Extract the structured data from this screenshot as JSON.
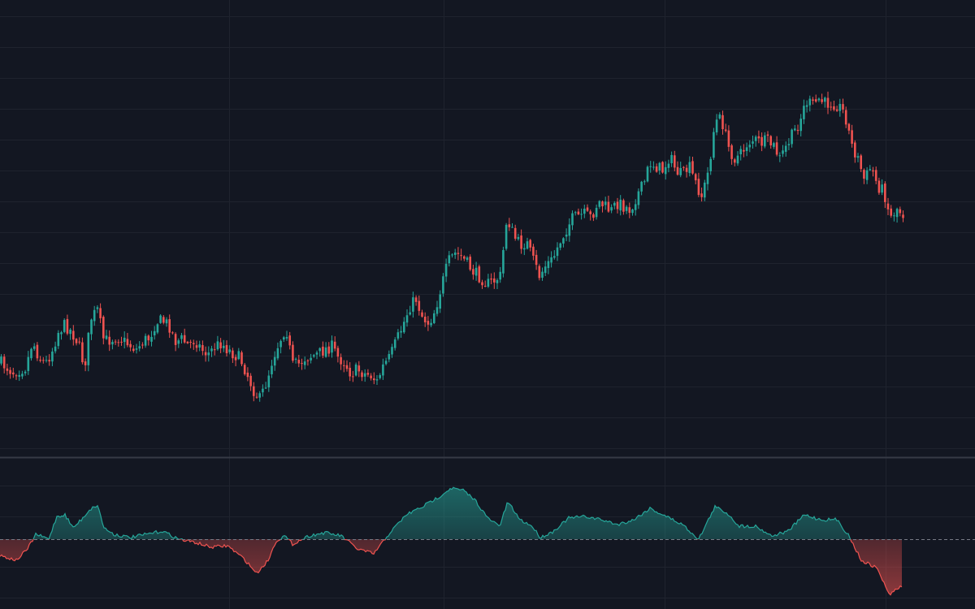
{
  "chart_data": [
    {
      "type": "candlestick",
      "title": "",
      "xlabel": "",
      "ylabel": "",
      "grid": true,
      "legend": "none",
      "colors": {
        "up": "#26a69a",
        "down": "#ef5350",
        "background": "#131722",
        "grid": "#1f232e"
      },
      "price_path": [
        [
          0,
          446
        ],
        [
          8,
          452
        ],
        [
          16,
          458
        ],
        [
          24,
          455
        ],
        [
          32,
          452
        ],
        [
          40,
          420
        ],
        [
          48,
          440
        ],
        [
          56,
          448
        ],
        [
          64,
          432
        ],
        [
          72,
          408
        ],
        [
          80,
          400
        ],
        [
          88,
          408
        ],
        [
          96,
          422
        ],
        [
          104,
          452
        ],
        [
          112,
          392
        ],
        [
          120,
          382
        ],
        [
          128,
          420
        ],
        [
          136,
          418
        ],
        [
          144,
          414
        ],
        [
          152,
          420
        ],
        [
          160,
          425
        ],
        [
          168,
          430
        ],
        [
          176,
          420
        ],
        [
          184,
          416
        ],
        [
          192,
          396
        ],
        [
          200,
          395
        ],
        [
          208,
          400
        ],
        [
          216,
          420
        ],
        [
          224,
          418
        ],
        [
          232,
          425
        ],
        [
          240,
          418
        ],
        [
          248,
          430
        ],
        [
          256,
          436
        ],
        [
          264,
          428
        ],
        [
          272,
          422
        ],
        [
          280,
          430
        ],
        [
          288,
          436
        ],
        [
          296,
          442
        ],
        [
          304,
          460
        ],
        [
          312,
          480
        ],
        [
          320,
          492
        ],
        [
          328,
          470
        ],
        [
          336,
          440
        ],
        [
          344,
          420
        ],
        [
          352,
          402
        ],
        [
          360,
          450
        ],
        [
          368,
          448
        ],
        [
          376,
          440
        ],
        [
          384,
          438
        ],
        [
          392,
          436
        ],
        [
          400,
          430
        ],
        [
          408,
          426
        ],
        [
          416,
          440
        ],
        [
          424,
          446
        ],
        [
          432,
          460
        ],
        [
          440,
          455
        ],
        [
          448,
          460
        ],
        [
          456,
          462
        ],
        [
          464,
          470
        ],
        [
          472,
          450
        ],
        [
          480,
          440
        ],
        [
          488,
          420
        ],
        [
          496,
          400
        ],
        [
          504,
          378
        ],
        [
          512,
          368
        ],
        [
          520,
          390
        ],
        [
          528,
          398
        ],
        [
          536,
          380
        ],
        [
          544,
          350
        ],
        [
          552,
          322
        ],
        [
          560,
          312
        ],
        [
          568,
          316
        ],
        [
          576,
          326
        ],
        [
          584,
          336
        ],
        [
          592,
          342
        ],
        [
          600,
          350
        ],
        [
          608,
          346
        ],
        [
          616,
          340
        ],
        [
          624,
          266
        ],
        [
          632,
          290
        ],
        [
          640,
          302
        ],
        [
          648,
          298
        ],
        [
          656,
          320
        ],
        [
          664,
          340
        ],
        [
          672,
          326
        ],
        [
          680,
          320
        ],
        [
          688,
          300
        ],
        [
          696,
          284
        ],
        [
          704,
          270
        ],
        [
          712,
          266
        ],
        [
          720,
          264
        ],
        [
          728,
          268
        ],
        [
          736,
          248
        ],
        [
          744,
          254
        ],
        [
          752,
          260
        ],
        [
          760,
          250
        ],
        [
          768,
          254
        ],
        [
          776,
          258
        ],
        [
          784,
          240
        ],
        [
          792,
          228
        ],
        [
          800,
          200
        ],
        [
          808,
          205
        ],
        [
          816,
          210
        ],
        [
          824,
          192
        ],
        [
          832,
          210
        ],
        [
          840,
          216
        ],
        [
          848,
          205
        ],
        [
          856,
          225
        ],
        [
          864,
          242
        ],
        [
          872,
          210
        ],
        [
          880,
          150
        ],
        [
          888,
          146
        ],
        [
          896,
          180
        ],
        [
          904,
          195
        ],
        [
          912,
          190
        ],
        [
          920,
          176
        ],
        [
          928,
          172
        ],
        [
          936,
          176
        ],
        [
          944,
          174
        ],
        [
          952,
          180
        ],
        [
          960,
          196
        ],
        [
          968,
          180
        ],
        [
          976,
          165
        ],
        [
          984,
          150
        ],
        [
          992,
          125
        ],
        [
          1000,
          130
        ],
        [
          1008,
          122
        ],
        [
          1016,
          128
        ],
        [
          1024,
          126
        ],
        [
          1032,
          130
        ],
        [
          1040,
          140
        ],
        [
          1048,
          178
        ],
        [
          1056,
          196
        ],
        [
          1064,
          222
        ],
        [
          1072,
          205
        ],
        [
          1080,
          228
        ],
        [
          1088,
          236
        ],
        [
          1096,
          268
        ],
        [
          1104,
          256
        ],
        [
          1112,
          264
        ]
      ],
      "histogram_path": [
        [
          0,
          684
        ],
        [
          20,
          690
        ],
        [
          34,
          676
        ],
        [
          44,
          658
        ],
        [
          60,
          664
        ],
        [
          70,
          636
        ],
        [
          80,
          634
        ],
        [
          90,
          650
        ],
        [
          100,
          640
        ],
        [
          110,
          628
        ],
        [
          120,
          622
        ],
        [
          128,
          650
        ],
        [
          140,
          658
        ],
        [
          160,
          662
        ],
        [
          180,
          658
        ],
        [
          200,
          654
        ],
        [
          220,
          664
        ],
        [
          240,
          668
        ],
        [
          260,
          674
        ],
        [
          280,
          672
        ],
        [
          300,
          688
        ],
        [
          316,
          706
        ],
        [
          330,
          690
        ],
        [
          340,
          666
        ],
        [
          350,
          660
        ],
        [
          360,
          670
        ],
        [
          380,
          660
        ],
        [
          400,
          656
        ],
        [
          420,
          660
        ],
        [
          440,
          676
        ],
        [
          460,
          682
        ],
        [
          480,
          656
        ],
        [
          500,
          634
        ],
        [
          520,
          624
        ],
        [
          540,
          612
        ],
        [
          555,
          601
        ],
        [
          570,
          604
        ],
        [
          585,
          616
        ],
        [
          600,
          638
        ],
        [
          615,
          648
        ],
        [
          625,
          618
        ],
        [
          640,
          640
        ],
        [
          655,
          648
        ],
        [
          665,
          662
        ],
        [
          680,
          655
        ],
        [
          700,
          638
        ],
        [
          720,
          636
        ],
        [
          740,
          640
        ],
        [
          760,
          646
        ],
        [
          780,
          640
        ],
        [
          800,
          626
        ],
        [
          820,
          636
        ],
        [
          840,
          646
        ],
        [
          860,
          664
        ],
        [
          880,
          624
        ],
        [
          895,
          632
        ],
        [
          910,
          648
        ],
        [
          930,
          648
        ],
        [
          950,
          660
        ],
        [
          970,
          654
        ],
        [
          990,
          634
        ],
        [
          1010,
          640
        ],
        [
          1030,
          640
        ],
        [
          1045,
          660
        ],
        [
          1060,
          690
        ],
        [
          1080,
          700
        ],
        [
          1094,
          732
        ],
        [
          1110,
          722
        ]
      ],
      "zero_line": 664
    }
  ]
}
